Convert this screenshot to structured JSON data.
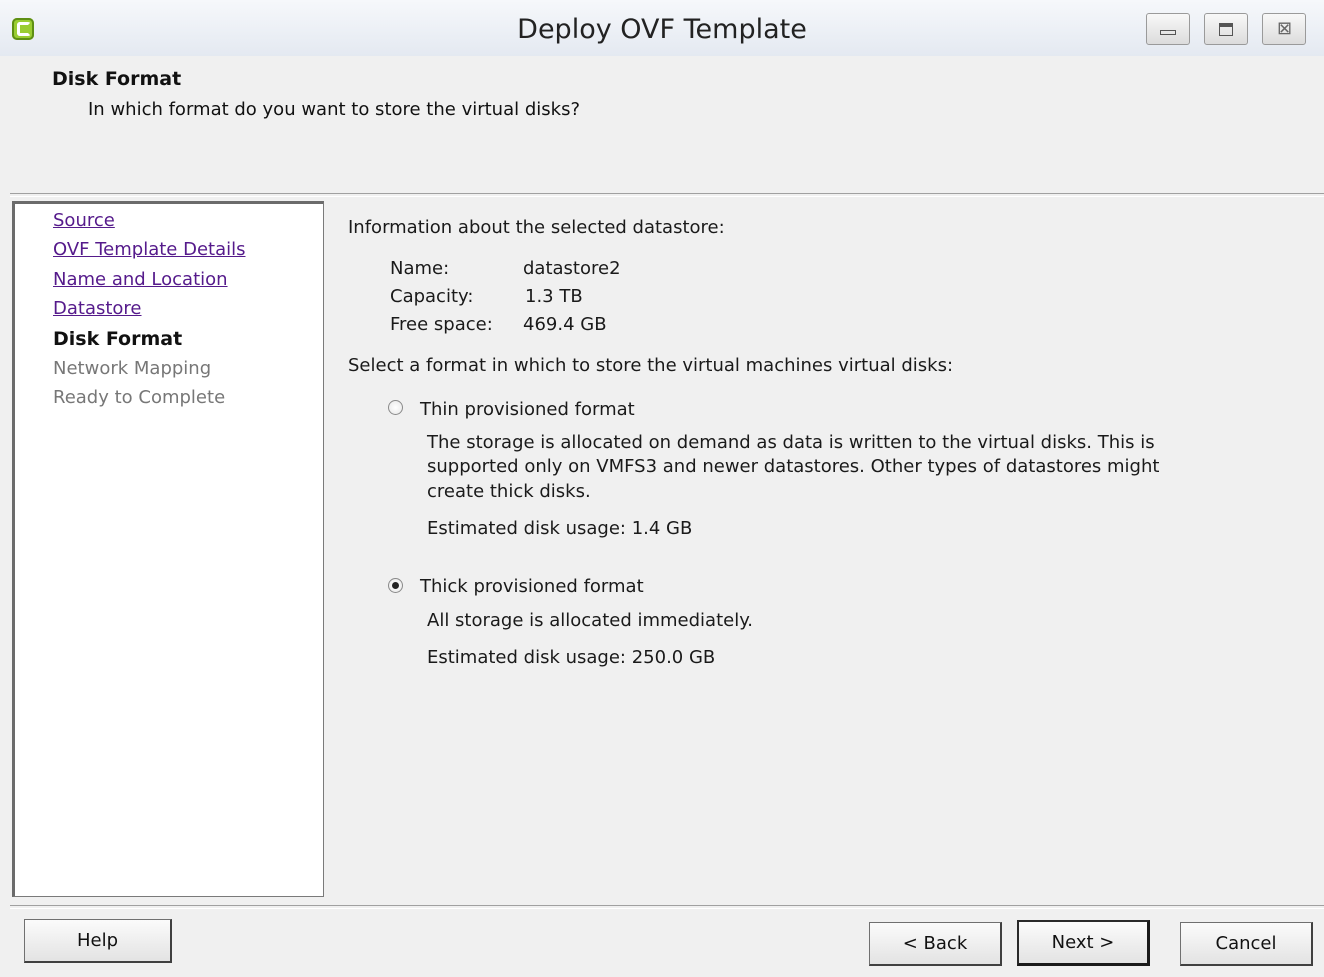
{
  "window": {
    "title": "Deploy OVF Template",
    "controls": {
      "minimize": "minimize",
      "maximize": "maximize",
      "close": "⊠"
    }
  },
  "header": {
    "title": "Disk Format",
    "subtitle": "In which format do you want to store the virtual disks?"
  },
  "nav": {
    "items": [
      {
        "label": "Source",
        "state": "visited"
      },
      {
        "label": "OVF Template Details",
        "state": "visited"
      },
      {
        "label": "Name and Location",
        "state": "visited"
      },
      {
        "label": "Datastore",
        "state": "visited"
      },
      {
        "label": "Disk Format",
        "state": "current"
      },
      {
        "label": "Network Mapping",
        "state": "future"
      },
      {
        "label": "Ready to Complete",
        "state": "future"
      }
    ]
  },
  "datastore_info": {
    "heading": "Information about the selected datastore:",
    "name_label": "Name:",
    "name_value": "datastore2",
    "capacity_label": "Capacity:",
    "capacity_value": "1.3 TB",
    "free_label": "Free space:",
    "free_value": "469.4 GB"
  },
  "format_select": {
    "heading": "Select a format in which to store the virtual machines virtual disks:",
    "options": [
      {
        "label": "Thin provisioned format",
        "selected": false,
        "desc_lines": [
          "The storage is allocated on demand as data is written to the virtual disks. This is",
          "supported only on VMFS3 and newer datastores. Other types of datastores might",
          "create thick disks."
        ],
        "usage": "Estimated disk usage: 1.4 GB"
      },
      {
        "label": "Thick provisioned format",
        "selected": true,
        "desc_lines": [
          "All storage is allocated immediately."
        ],
        "usage": "Estimated disk usage: 250.0 GB"
      }
    ]
  },
  "buttons": {
    "help": "Help",
    "back": "< Back",
    "next": "Next >",
    "cancel": "Cancel"
  },
  "colors": {
    "visited_link": "#551a8b",
    "future_step": "#777777",
    "panel_bg": "#f0f0f0"
  }
}
